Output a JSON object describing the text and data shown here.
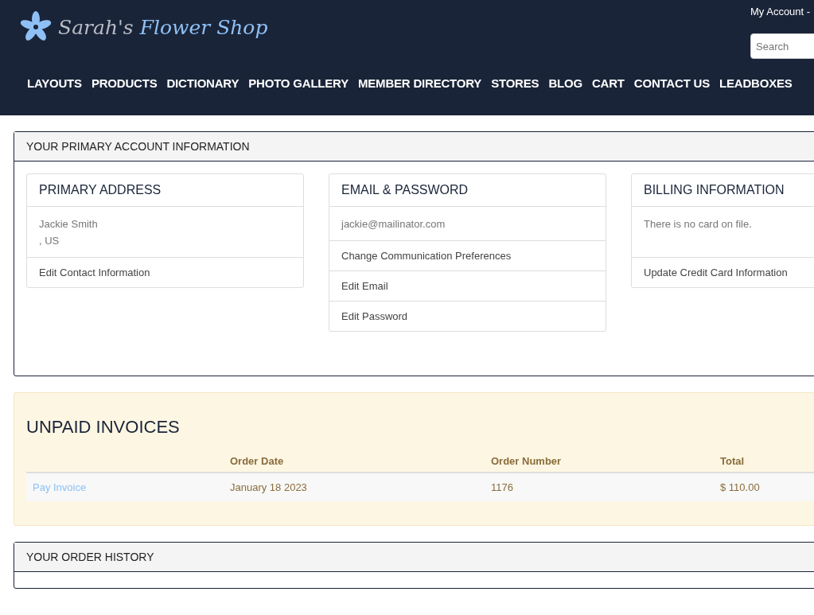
{
  "header": {
    "brand": {
      "first": "Sarah's",
      "rest": "Flower Shop"
    },
    "account_link": "My Account -",
    "search": {
      "placeholder": "Search"
    },
    "nav": [
      "LAYOUTS",
      "PRODUCTS",
      "DICTIONARY",
      "PHOTO GALLERY",
      "MEMBER DIRECTORY",
      "STORES",
      "BLOG",
      "CART",
      "CONTACT US",
      "LEADBOXES"
    ]
  },
  "account_panel": {
    "title": "YOUR PRIMARY ACCOUNT INFORMATION",
    "cards": [
      {
        "title": "PRIMARY ADDRESS",
        "info": [
          "Jackie Smith",
          ", US"
        ],
        "links": [
          "Edit Contact Information"
        ]
      },
      {
        "title": "EMAIL & PASSWORD",
        "info": [
          "jackie@mailinator.com"
        ],
        "links": [
          "Change Communication Preferences",
          "Edit Email",
          "Edit Password"
        ]
      },
      {
        "title": "BILLING INFORMATION",
        "info": [
          "There is no card on file."
        ],
        "links": [
          "Update Credit Card Information"
        ]
      }
    ]
  },
  "unpaid_invoices": {
    "title": "UNPAID INVOICES",
    "columns": [
      "",
      "Order Date",
      "Order Number",
      "Total"
    ],
    "rows": [
      {
        "action": "Pay Invoice",
        "date": "January 18 2023",
        "number": "1176",
        "total": "$ 110.00"
      }
    ]
  },
  "order_history": {
    "title": "YOUR ORDER HISTORY"
  }
}
